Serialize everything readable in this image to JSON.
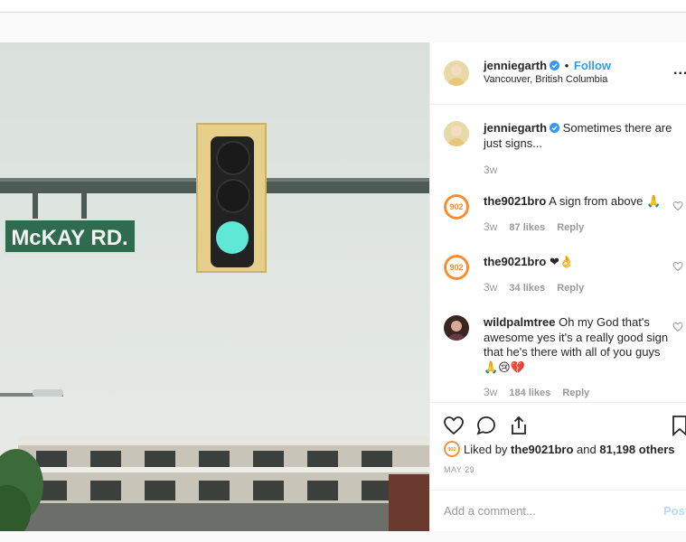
{
  "post": {
    "author": "jenniegarth",
    "follow_label": "Follow",
    "separator": "•",
    "location": "Vancouver, British Columbia",
    "more_icon": "more-options-icon",
    "more_label": "..."
  },
  "photo": {
    "street_sign": "McKAY RD.",
    "traffic_light_color": "#5fe8d6"
  },
  "comments": [
    {
      "user": "jenniegarth",
      "text": "Sometimes there are just signs...",
      "age": "3w",
      "likes": "",
      "reply": ""
    },
    {
      "user": "the9021bro",
      "text": "A sign from above 🙏",
      "age": "3w",
      "likes": "87 likes",
      "reply": "Reply"
    },
    {
      "user": "the9021bro",
      "text": "❤👌",
      "age": "3w",
      "likes": "34 likes",
      "reply": "Reply"
    },
    {
      "user": "wildpalmtree",
      "text": "Oh my God that's awesome yes it's a really good sign that he's there with all of you guys🙏😢💔",
      "age": "3w",
      "likes": "184 likes",
      "reply": "Reply"
    }
  ],
  "actions": {
    "icons": [
      "heart-icon",
      "comment-icon",
      "share-icon",
      "bookmark-icon"
    ],
    "liked_prefix": "Liked by",
    "liked_user": "the9021bro",
    "liked_and": "and",
    "liked_others": "81,198 others",
    "date": "MAY 29"
  },
  "add_comment": {
    "placeholder": "Add a comment...",
    "post_label": "Post"
  },
  "colors": {
    "accent": "#3897f0",
    "post_disabled": "#b3dbff",
    "verified": "#3897f0",
    "bro_avatar": "#ff8a2b"
  }
}
